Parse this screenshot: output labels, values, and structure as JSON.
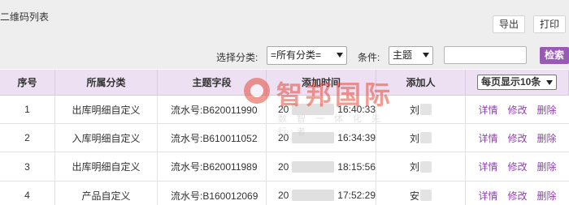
{
  "page_title": "二维码列表",
  "toolbar": {
    "export_label": "导出",
    "print_label": "打印"
  },
  "filters": {
    "category_label": "选择分类:",
    "category_value": "=所有分类=",
    "condition_label": "条件:",
    "condition_value": "主题",
    "search_value": "",
    "search_label": "检索"
  },
  "table": {
    "headers": [
      "序号",
      "所属分类",
      "主题字段",
      "添加时间",
      "添加人"
    ],
    "page_size_label": "每页显示10条",
    "rows": [
      {
        "index": "1",
        "category": "出库明细自定义",
        "subject": "流水号:B620011990",
        "date_prefix": "20",
        "time": "16:40:33",
        "adder": "刘"
      },
      {
        "index": "2",
        "category": "入库明细自定义",
        "subject": "流水号:B610011052",
        "date_prefix": "20",
        "time": "16:34:39",
        "adder": "刘"
      },
      {
        "index": "3",
        "category": "出库明细自定义",
        "subject": "流水号:B620011989",
        "date_prefix": "20",
        "time": "18:15:56",
        "adder": "刘"
      },
      {
        "index": "4",
        "category": "产品自定义",
        "subject": "流水号:B160012069",
        "date_prefix": "20",
        "time": "17:52:29",
        "adder": "安"
      }
    ],
    "actions": {
      "detail": "详情",
      "edit": "修改",
      "delete": "删除"
    }
  },
  "watermark": {
    "title": "智邦国际",
    "subtitle": "数智一体化先行者"
  },
  "colors": {
    "accent": "#9b59b6",
    "header_bg": "#ede0f3",
    "link": "#8e44ad",
    "watermark": "#e74c3c"
  }
}
